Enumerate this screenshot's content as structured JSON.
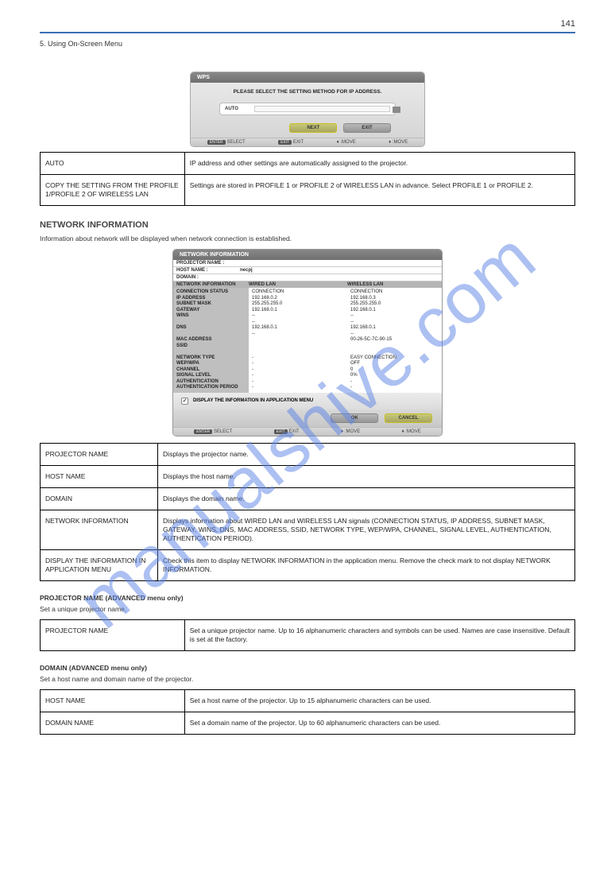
{
  "page_number": "141",
  "header_left": "5. Using On-Screen Menu",
  "header_right": "",
  "dlg1": {
    "title": "WPS",
    "prompt": "PLEASE SELECT THE SETTING METHOD FOR IP ADDRESS.",
    "select_label": "AUTO",
    "btn_next": "NEXT",
    "btn_exit": "EXIT",
    "hints": [
      "SELECT",
      "EXIT",
      ":MOVE",
      ":MOVE"
    ]
  },
  "table1": [
    {
      "k": "AUTO",
      "v": "IP address and other settings are automatically assigned to the projector."
    },
    {
      "k": "COPY THE SETTING FROM THE PROFILE 1/PROFILE 2 OF WIRELESS LAN",
      "v": "Settings are stored in PROFILE 1 or PROFILE 2 of WIRELESS LAN in advance. Select PROFILE 1 or PROFILE 2."
    }
  ],
  "section_ni": "NETWORK INFORMATION",
  "section_ni_sub": "Information about network will be displayed when network connection is established.",
  "dlg2": {
    "title": "NETWORK INFORMATION",
    "projector_name_k": "PROJECTOR NAME :",
    "host_name_k": "HOST NAME :",
    "host_name_v": "necpj",
    "domain_k": "DOMAIN :",
    "col_ni": "NETWORK INFORMATION",
    "col_wired": "WIRED LAN",
    "col_wireless": "WIRELESS LAN",
    "keys": [
      "CONNECTION STATUS",
      "IP ADDRESS",
      "SUBNET MASK",
      "GATEWAY",
      "WINS",
      "",
      "DNS",
      "",
      "MAC ADDRESS",
      "SSID",
      "",
      "NETWORK TYPE",
      "WEP/WPA",
      "CHANNEL",
      "SIGNAL LEVEL",
      "AUTHENTICATION",
      "AUTHENTICATION PERIOD"
    ],
    "wired": [
      "CONNECTION",
      "192.168.0.2",
      "255.255.255.0",
      "192.168.0.1",
      "--",
      "--",
      "192.168.0.1",
      "--",
      "",
      "",
      "",
      "-",
      "-",
      "-",
      "-",
      "-",
      "-"
    ],
    "wireless": [
      "CONNECTION",
      "192.168.0.3",
      "255.255.255.0",
      "192.168.0.1",
      "--",
      "--",
      "192.168.0.1",
      "--",
      "00-26-5C-7C-90-15",
      "",
      "",
      "EASY CONNECTION",
      "OFF",
      "0",
      "0%",
      "-",
      "-"
    ],
    "check_label": "DISPLAY THE INFORMATION IN APPLICATION MENU",
    "btn_ok": "OK",
    "btn_cancel": "CANCEL",
    "hints": [
      "SELECT",
      "EXIT",
      ":MOVE",
      ":MOVE"
    ]
  },
  "table2": [
    {
      "k": "PROJECTOR NAME",
      "v": "Displays the projector name."
    },
    {
      "k": "HOST NAME",
      "v": "Displays the host name."
    },
    {
      "k": "DOMAIN",
      "v": "Displays the domain name."
    },
    {
      "k": "NETWORK INFORMATION",
      "v": "Displays information about WIRED LAN and WIRELESS LAN signals (CONNECTION STATUS, IP ADDRESS, SUBNET MASK, GATEWAY, WINS, DNS, MAC ADDRESS, SSID, NETWORK TYPE, WEP/WPA, CHANNEL, SIGNAL LEVEL, AUTHENTICATION, AUTHENTICATION PERIOD)."
    },
    {
      "k": "DISPLAY THE INFORMATION IN APPLICATION MENU",
      "v": "Check this item to display NETWORK INFORMATION in the application menu. Remove the check mark to not display NETWORK INFORMATION."
    }
  ],
  "subhead_pn": "PROJECTOR NAME (ADVANCED menu only)",
  "subhead_pn_sub": "Set a unique projector name.",
  "table3": [
    {
      "k": "PROJECTOR NAME",
      "v": "Set a unique projector name. Up to 16 alphanumeric characters and symbols can be used.\nNames are case insensitive. Default is set at the factory."
    }
  ],
  "subhead_dm": "DOMAIN (ADVANCED menu only)",
  "subhead_dm_sub": "Set a host name and domain name of the projector.",
  "table4": [
    {
      "k": "HOST NAME",
      "v": "Set a host name of the projector. Up to 15 alphanumeric characters can be used."
    },
    {
      "k": "DOMAIN NAME",
      "v": "Set a domain name of the projector. Up to 60 alphanumeric characters can be used."
    }
  ],
  "watermark": "manualshive.com"
}
